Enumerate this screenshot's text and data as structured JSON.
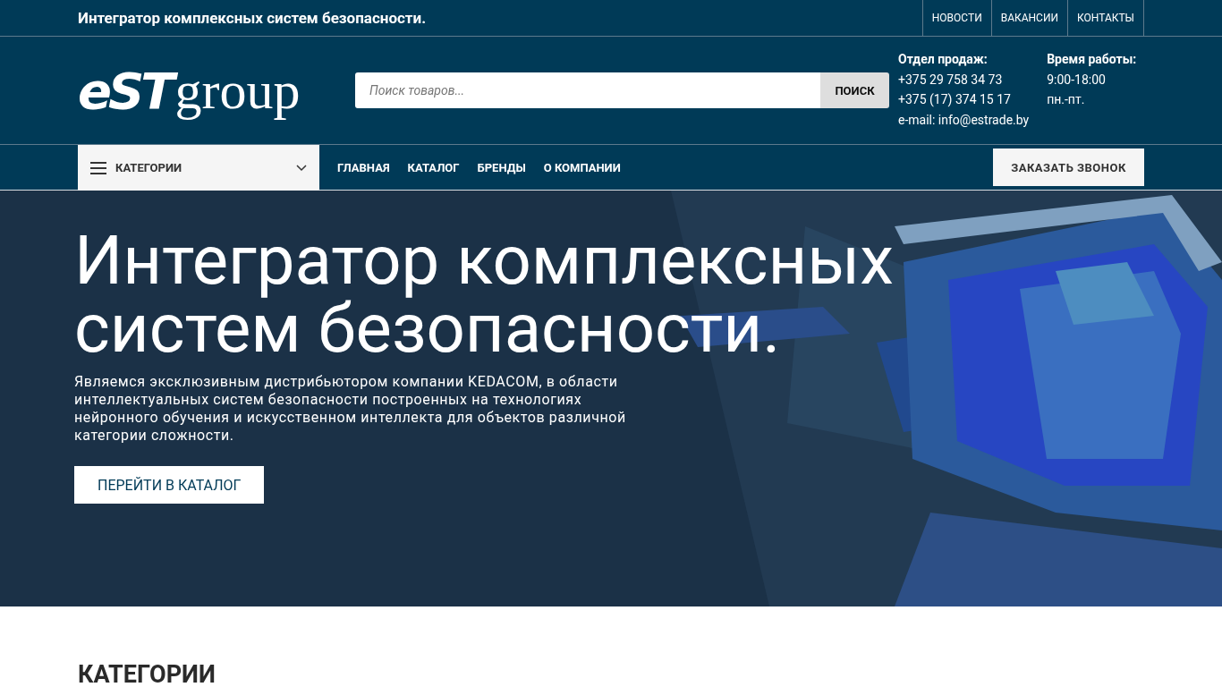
{
  "top_bar": {
    "tagline": "Интегратор комплексных систем безопасности.",
    "links": [
      "НОВОСТИ",
      "ВАКАНСИИ",
      "КОНТАКТЫ"
    ]
  },
  "header": {
    "logo": {
      "mark": "eST",
      "word": "group"
    },
    "search": {
      "placeholder": "Поиск товаров...",
      "button": "ПОИСК"
    },
    "contacts": [
      {
        "title": "Отдел продаж:",
        "lines": [
          "+375 29 758 34 73",
          "+375 (17) 374 15 17",
          "e-mail: info@estrade.by"
        ]
      },
      {
        "title": "Время работы:",
        "lines": [
          "9:00-18:00",
          "пн.-пт."
        ]
      }
    ]
  },
  "nav": {
    "categories": "КАТЕГОРИИ",
    "links": [
      "ГЛАВНАЯ",
      "КАТАЛОГ",
      "БРЕНДЫ",
      "О КОМПАНИИ"
    ],
    "callback": "ЗАКАЗАТЬ ЗВОНОК"
  },
  "hero": {
    "title": "Интегратор комплексных систем безопасности.",
    "text": "Являемся эксклюзивным дистрибьютором компании KEDACOM, в области интеллектуальных систем безопасности построенных на технологиях нейронного обучения и искусственном интеллекта для объектов различной категории сложности.",
    "button": "ПЕРЕЙТИ В КАТАЛОГ"
  },
  "section": {
    "title": "КАТЕГОРИИ"
  }
}
